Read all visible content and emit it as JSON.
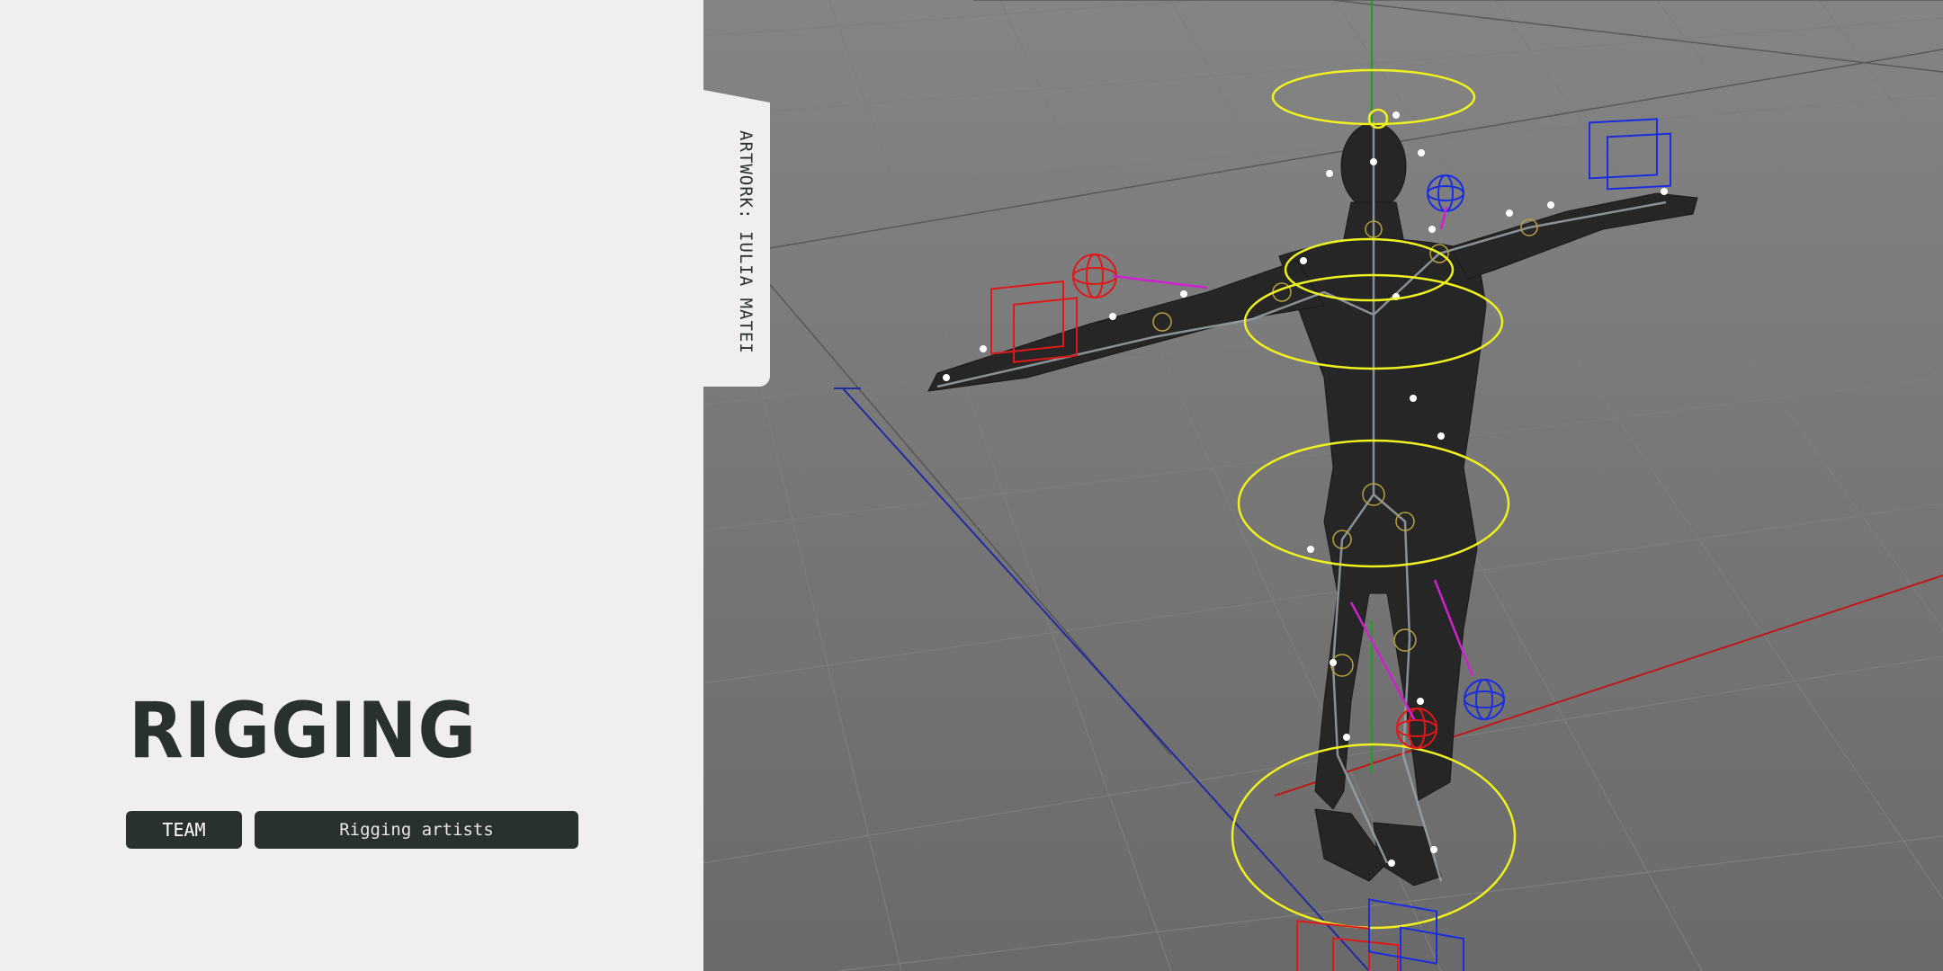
{
  "title": "RIGGING",
  "tags": {
    "team_label": "TEAM",
    "team_value": "Rigging artists"
  },
  "credit": "ARTWORK: IULIA MATEI",
  "colors": {
    "panel_bg": "#efefef",
    "ink": "#283030",
    "viewport_bg": "#7a7a7a",
    "control_yellow": "#f0f020",
    "control_red": "#e01818",
    "control_blue": "#1a2de0",
    "pole_magenta": "#d020d0"
  },
  "icons": {
    "viewport": "3d-rig-viewport"
  }
}
